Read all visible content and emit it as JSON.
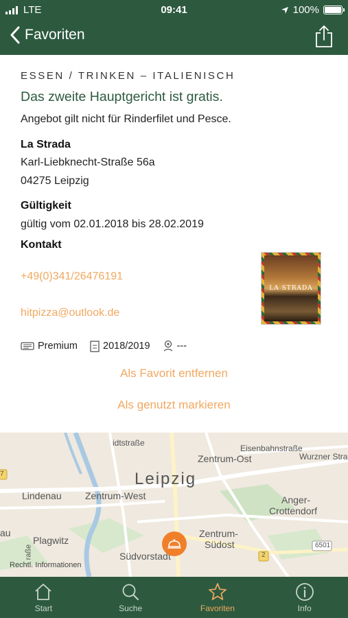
{
  "status_bar": {
    "carrier": "LTE",
    "time": "09:41",
    "battery": "100%",
    "battery_level": 1.0
  },
  "nav": {
    "back_label": "Favoriten",
    "share_icon": "share-icon"
  },
  "offer": {
    "category": "ESSEN / TRINKEN – ITALIENISCH",
    "headline": "Das zweite Hauptgericht ist gratis.",
    "condition": "Angebot gilt nicht für Rinderfilet und Pesce.",
    "venue_name": "La Strada",
    "street": "Karl-Liebknecht-Straße 56a",
    "city": "04275 Leipzig",
    "validity_heading": "Gültigkeit",
    "validity_text": "gültig vom 02.01.2018 bis 28.02.2019",
    "contact_heading": "Kontakt",
    "phone": "+49(0)341/26476191",
    "email": "hitpizza@outlook.de",
    "thumbnail_text": "LA STRADA",
    "meta": {
      "tier": "Premium",
      "season": "2018/2019",
      "distance": "---"
    },
    "actions": {
      "remove_favorite": "Als Favorit entfernen",
      "mark_used": "Als genutzt markieren"
    }
  },
  "map": {
    "city": "Leipzig",
    "labels": {
      "eisenbahnstrasse": "Eisenbahnstraße",
      "zentrum_ost": "Zentrum-Ost",
      "wurzner": "Wurzner Stra",
      "lindenau": "Lindenau",
      "zentrum_west": "Zentrum-West",
      "anger1": "Anger-",
      "anger2": "Crottendorf",
      "plagwitz": "Plagwitz",
      "zentrum_suedost1": "Zentrum-",
      "zentrum_suedost2": "Südost",
      "suedvorstadt": "Südvorstadt",
      "stadtstrasse": "idtstraße",
      "au": "au",
      "strasse_side": "raße",
      "road_6501": "6501",
      "road_2": "2",
      "road_7": "7"
    },
    "legal": "Rechtl. Informationen"
  },
  "tabs": [
    {
      "label": "Start",
      "icon": "home-icon"
    },
    {
      "label": "Suche",
      "icon": "search-icon"
    },
    {
      "label": "Favoriten",
      "icon": "star-icon"
    },
    {
      "label": "Info",
      "icon": "info-icon"
    }
  ],
  "colors": {
    "brand_green": "#2d5a3f",
    "accent_orange": "#f0a860",
    "pin_orange": "#f07f2a"
  }
}
